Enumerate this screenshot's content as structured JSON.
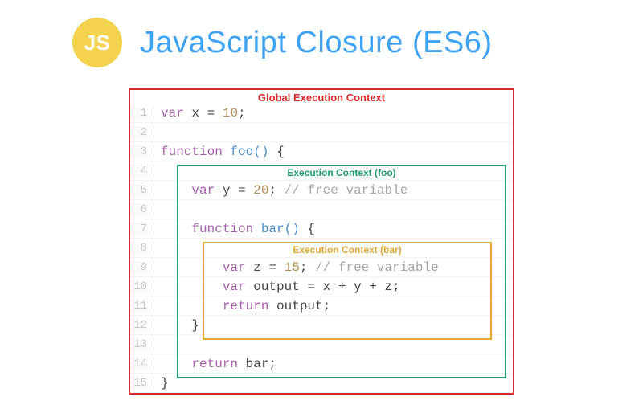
{
  "header": {
    "badge": "JS",
    "title": "JavaScript Closure (ES6)"
  },
  "contexts": {
    "global": "Global Execution Context",
    "foo": "Execution Context (foo)",
    "bar": "Execution Context (bar)"
  },
  "code": {
    "l1": {
      "n": "1",
      "var": "var",
      "id": "x",
      "eq": " = ",
      "val": "10",
      "end": ";"
    },
    "l2": {
      "n": "2"
    },
    "l3": {
      "n": "3",
      "fn": "function",
      "name": " foo",
      "paren": "()",
      "brace": " {"
    },
    "l4": {
      "n": "4"
    },
    "l5": {
      "n": "5",
      "var": "var",
      "id": "y",
      "eq": " = ",
      "val": "20",
      "end": ";",
      "cmt": " // free variable"
    },
    "l6": {
      "n": "6"
    },
    "l7": {
      "n": "7",
      "fn": "function",
      "name": " bar",
      "paren": "()",
      "brace": " {"
    },
    "l8": {
      "n": "8"
    },
    "l9": {
      "n": "9",
      "var": "var",
      "id": "z",
      "eq": " = ",
      "val": "15",
      "end": ";",
      "cmt": " // free variable"
    },
    "l10": {
      "n": "10",
      "var": "var",
      "id": "output",
      "eq": " = ",
      "expr": "x + y + z",
      "end": ";"
    },
    "l11": {
      "n": "11",
      "ret": "return",
      "id": " output",
      "end": ";"
    },
    "l12": {
      "n": "12",
      "brace": "}"
    },
    "l13": {
      "n": "13"
    },
    "l14": {
      "n": "14",
      "ret": "return",
      "id": " bar",
      "end": ";"
    },
    "l15": {
      "n": "15",
      "brace": "}"
    }
  }
}
